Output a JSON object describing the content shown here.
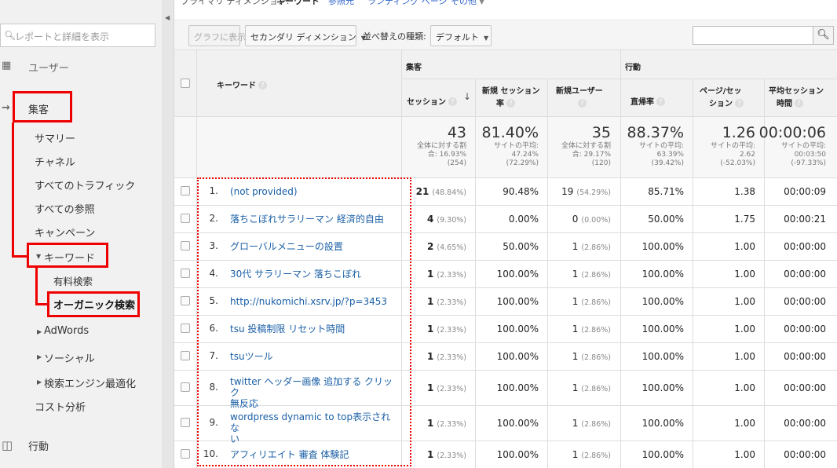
{
  "sidebar": {
    "search_placeholder": "レポートと詳細を表示",
    "items": {
      "users": "ユーザー",
      "acquisition": "集客",
      "summary": "サマリー",
      "channels": "チャネル",
      "all_traffic": "すべてのトラフィック",
      "all_referrals": "すべての参照",
      "campaigns": "キャンペーン",
      "keywords": "キーワード",
      "paid": "有料検索",
      "organic": "オーガニック検索",
      "adwords": "AdWords",
      "social": "ソーシャル",
      "seo": "検索エンジン最適化",
      "cost": "コスト分析",
      "behavior": "行動"
    }
  },
  "tabs": {
    "primary": "プライマリ ディメンション:",
    "keyword": "キーワード",
    "ref_source": "参照元",
    "landing": "ランディング ページ",
    "other": "その他"
  },
  "toolbar": {
    "graph": "グラフに表示",
    "secondary": "セカンダリ ディメンション",
    "sort_label": "並べ替えの種類:",
    "sort_value": "デフォルト"
  },
  "table": {
    "keyword_header": "キーワード",
    "group_acq": "集客",
    "group_beh": "行動",
    "columns": {
      "sessions": "セッション",
      "new_sess_1": "新規 セッション",
      "new_sess_2": "率",
      "new_users": "新規ユーザー",
      "bounce": "直帰率",
      "pps_1": "ページ/セッ",
      "pps_2": "ション",
      "dur_1": "平均セッション",
      "dur_2": "時間"
    },
    "totals": {
      "sessions": "43",
      "sessions_s1": "全体に対する割",
      "sessions_s2": "合: 16.93%",
      "sessions_s3": "(254)",
      "new_sess": "81.40%",
      "new_sess_s1": "サイトの平均:",
      "new_sess_s2": "47.24%",
      "new_sess_s3": "(72.29%)",
      "new_users": "35",
      "new_users_s1": "全体に対する割",
      "new_users_s2": "合: 29.17%",
      "new_users_s3": "(120)",
      "bounce": "88.37%",
      "bounce_s1": "サイトの平均:",
      "bounce_s2": "63.39%",
      "bounce_s3": "(39.42%)",
      "pps": "1.26",
      "pps_s1": "サイトの平均:",
      "pps_s2": "2.62",
      "pps_s3": "(-52.03%)",
      "dur": "00:00:06",
      "dur_s1": "サイトの平均:",
      "dur_s2": "00:03:50",
      "dur_s3": "(-97.33%)"
    },
    "rows": [
      {
        "n": "1.",
        "kw1": "(not provided)",
        "kw2": "",
        "s": "21",
        "sp": "(48.84%)",
        "ns": "90.48%",
        "nu": "19",
        "nup": "(54.29%)",
        "br": "85.71%",
        "pps": "1.38",
        "dur": "00:00:09"
      },
      {
        "n": "2.",
        "kw1": "落ちこぼれサラリーマン 経済的自由",
        "kw2": "",
        "s": "4",
        "sp": "(9.30%)",
        "ns": "0.00%",
        "nu": "0",
        "nup": "(0.00%)",
        "br": "50.00%",
        "pps": "1.75",
        "dur": "00:00:21"
      },
      {
        "n": "3.",
        "kw1": "グローバルメニューの設置",
        "kw2": "",
        "s": "2",
        "sp": "(4.65%)",
        "ns": "50.00%",
        "nu": "1",
        "nup": "(2.86%)",
        "br": "100.00%",
        "pps": "1.00",
        "dur": "00:00:00"
      },
      {
        "n": "4.",
        "kw1": "30代 サラリーマン 落ちこぼれ",
        "kw2": "",
        "s": "1",
        "sp": "(2.33%)",
        "ns": "100.00%",
        "nu": "1",
        "nup": "(2.86%)",
        "br": "100.00%",
        "pps": "1.00",
        "dur": "00:00:00"
      },
      {
        "n": "5.",
        "kw1": "http://nukomichi.xsrv.jp/?p=3453",
        "kw2": "",
        "s": "1",
        "sp": "(2.33%)",
        "ns": "100.00%",
        "nu": "1",
        "nup": "(2.86%)",
        "br": "100.00%",
        "pps": "1.00",
        "dur": "00:00:00"
      },
      {
        "n": "6.",
        "kw1": "tsu 投稿制限 リセット時間",
        "kw2": "",
        "s": "1",
        "sp": "(2.33%)",
        "ns": "100.00%",
        "nu": "1",
        "nup": "(2.86%)",
        "br": "100.00%",
        "pps": "1.00",
        "dur": "00:00:00"
      },
      {
        "n": "7.",
        "kw1": "tsuツール",
        "kw2": "",
        "s": "1",
        "sp": "(2.33%)",
        "ns": "100.00%",
        "nu": "1",
        "nup": "(2.86%)",
        "br": "100.00%",
        "pps": "1.00",
        "dur": "00:00:00"
      },
      {
        "n": "8.",
        "kw1": "twitter ヘッダー画像 追加する クリック",
        "kw2": "無反応",
        "s": "1",
        "sp": "(2.33%)",
        "ns": "100.00%",
        "nu": "1",
        "nup": "(2.86%)",
        "br": "100.00%",
        "pps": "1.00",
        "dur": "00:00:00"
      },
      {
        "n": "9.",
        "kw1": "wordpress dynamic to top表示されな",
        "kw2": "い",
        "s": "1",
        "sp": "(2.33%)",
        "ns": "100.00%",
        "nu": "1",
        "nup": "(2.86%)",
        "br": "100.00%",
        "pps": "1.00",
        "dur": "00:00:00"
      },
      {
        "n": "10.",
        "kw1": "アフィリエイト 審査 体験記",
        "kw2": "",
        "s": "1",
        "sp": "(2.33%)",
        "ns": "100.00%",
        "nu": "1",
        "nup": "(2.86%)",
        "br": "100.00%",
        "pps": "1.00",
        "dur": "00:00:00"
      }
    ]
  },
  "colors": {
    "highlight": "#e00000",
    "link": "#1a5fa6"
  }
}
